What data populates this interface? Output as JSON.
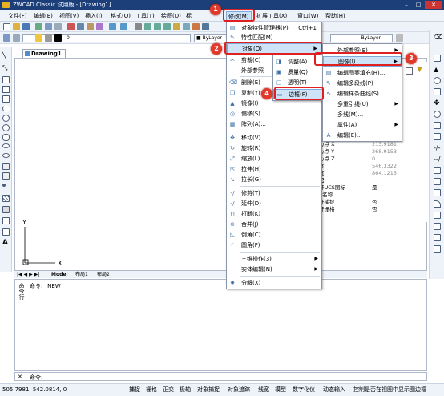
{
  "window": {
    "title": "ZWCAD Classic 试用版 - [Drawing1]"
  },
  "menubar": [
    "文件(F)",
    "编辑(E)",
    "视图(V)",
    "插入(I)",
    "格式(O)",
    "工具(T)",
    "绘图(D)",
    "标",
    "修改(M)",
    "扩展工具(X)",
    "窗口(W)",
    "帮助(H)"
  ],
  "toolbar2": {
    "layer_value": "0",
    "linetype_value": "ByLayer",
    "lineweight_value": "ByLayer"
  },
  "doc_tab": "Drawing1",
  "layout_tabs": [
    "Model",
    "布局1",
    "布局2"
  ],
  "modify_menu": [
    {
      "label": "对象特性管理器(P)",
      "shortcut": "Ctrl+1",
      "icon": "properties-icon"
    },
    {
      "label": "特性匹配(M)",
      "icon": "match-icon"
    },
    {
      "label": "对象(O)",
      "submenu": true,
      "highlighted": true
    },
    {
      "label": "剪裁(C)",
      "icon": "clip-icon"
    },
    {
      "label": "外部参照",
      "icon": ""
    },
    {
      "label": "删除(E)",
      "icon": "erase-icon"
    },
    {
      "label": "复制(Y)",
      "icon": "copy-icon"
    },
    {
      "label": "镜像(I)",
      "icon": "mirror-icon"
    },
    {
      "label": "偏移(S)",
      "icon": "offset-icon"
    },
    {
      "label": "阵列(A)...",
      "icon": "array-icon"
    },
    {
      "label": "移动(V)",
      "icon": "move-icon"
    },
    {
      "label": "旋转(R)",
      "icon": "rotate-icon"
    },
    {
      "label": "缩放(L)",
      "icon": "scale-icon"
    },
    {
      "label": "拉伸(H)",
      "icon": "stretch-icon"
    },
    {
      "label": "拉长(G)",
      "icon": "lengthen-icon"
    },
    {
      "label": "修剪(T)",
      "icon": "trim-icon"
    },
    {
      "label": "延伸(D)",
      "icon": "extend-icon"
    },
    {
      "label": "打断(K)",
      "icon": "break-icon"
    },
    {
      "label": "合并(J)",
      "icon": "join-icon"
    },
    {
      "label": "倒角(C)",
      "icon": "chamfer-icon"
    },
    {
      "label": "圆角(F)",
      "icon": "fillet-icon"
    },
    {
      "label": "三维操作(3)",
      "submenu": true
    },
    {
      "label": "实体编辑(N)",
      "submenu": true
    },
    {
      "label": "分解(X)",
      "icon": "explode-icon"
    }
  ],
  "clip_submenu": [
    {
      "label": "调整(A)..."
    },
    {
      "label": "质量(Q)"
    },
    {
      "label": "透明(T)"
    },
    {
      "label": "边框(F)",
      "highlighted": true
    }
  ],
  "object_submenu": [
    {
      "label": "外部参照(E)",
      "submenu": true
    },
    {
      "label": "图像(I)",
      "submenu": true,
      "highlighted": true
    },
    {
      "label": "编辑图案填充(H)..."
    },
    {
      "label": "编辑多段线(P)"
    },
    {
      "label": "编辑样条曲线(S)"
    },
    {
      "label": "多重引线(U)",
      "submenu": true
    },
    {
      "label": "多线(M)..."
    },
    {
      "label": "属性(A)",
      "submenu": true
    },
    {
      "label": "编辑(E)..."
    }
  ],
  "props": [
    {
      "k": "心点 X",
      "v": "213.9181"
    },
    {
      "k": "心点 Y",
      "v": "268.9153"
    },
    {
      "k": "心点 Z",
      "v": "0"
    },
    {
      "k": "度",
      "v": "546.3322"
    },
    {
      "k": "度",
      "v": "864.1215"
    },
    {
      "k": "它",
      "v": ""
    },
    {
      "k": "开UCS图标",
      "v": "是"
    },
    {
      "k": "S名称",
      "v": ""
    },
    {
      "k": "开捕捉",
      "v": "否"
    },
    {
      "k": "开栅格",
      "v": "否"
    }
  ],
  "command": {
    "line1": "命令: _NEW",
    "label": "命令:",
    "side_label": "命令行"
  },
  "status": {
    "coords": "505.7981, 542.0814, 0",
    "buttons": [
      "捕捉",
      "栅格",
      "正交",
      "极轴",
      "对象捕捉",
      "对象追踪",
      "线宽",
      "模型",
      "数字化仪",
      "动态输入",
      "控制是否在视图中显示图边框"
    ]
  },
  "badges": [
    "1",
    "2",
    "3",
    "4"
  ],
  "colors": {
    "title_bg": "#1c3f7a",
    "badge": "#e03a2a",
    "highlight_box": "#e02020"
  }
}
